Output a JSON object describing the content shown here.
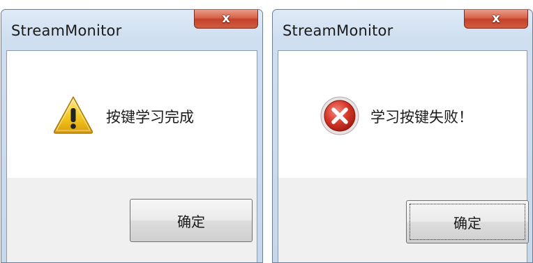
{
  "dialogs": [
    {
      "title": "StreamMonitor",
      "close_label": "x",
      "icon": "warning-icon",
      "message": "按键学习完成",
      "ok_label": "确定"
    },
    {
      "title": "StreamMonitor",
      "close_label": "x",
      "icon": "error-icon",
      "message": "学习按键失败！",
      "ok_label": "确定"
    }
  ],
  "colors": {
    "close_button": "#c3422a",
    "error_red": "#c0281c",
    "warning_yellow": "#f2c41c"
  }
}
